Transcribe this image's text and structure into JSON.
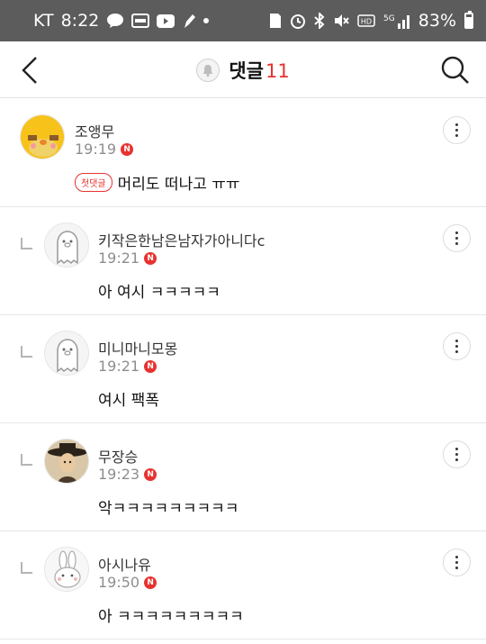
{
  "statusbar": {
    "carrier": "KT",
    "time": "8:22",
    "battery": "83%"
  },
  "header": {
    "title": "댓글",
    "count": "11"
  },
  "first_badge_label": "첫댓글",
  "comments": [
    {
      "name": "조앵무",
      "time": "19:19",
      "text": "머리도 떠나고 ㅠㅠ",
      "reply": false,
      "first": true
    },
    {
      "name": "키작은한남은남자가아니다c",
      "time": "19:21",
      "text": "아 여시 ㅋㅋㅋㅋㅋ",
      "reply": true
    },
    {
      "name": "미니마니모몽",
      "time": "19:21",
      "text": "여시 팩폭",
      "reply": true
    },
    {
      "name": "무장승",
      "time": "19:23",
      "text": "악ㅋㅋㅋㅋㅋㅋㅋㅋㅋ",
      "reply": true
    },
    {
      "name": "아시나유",
      "time": "19:50",
      "text": "아 ㅋㅋㅋㅋㅋㅋㅋㅋㅋ",
      "reply": true
    }
  ],
  "new_badge": "N",
  "colors": {
    "accent": "#e8322f",
    "statusbar": "#5c5c5c"
  }
}
